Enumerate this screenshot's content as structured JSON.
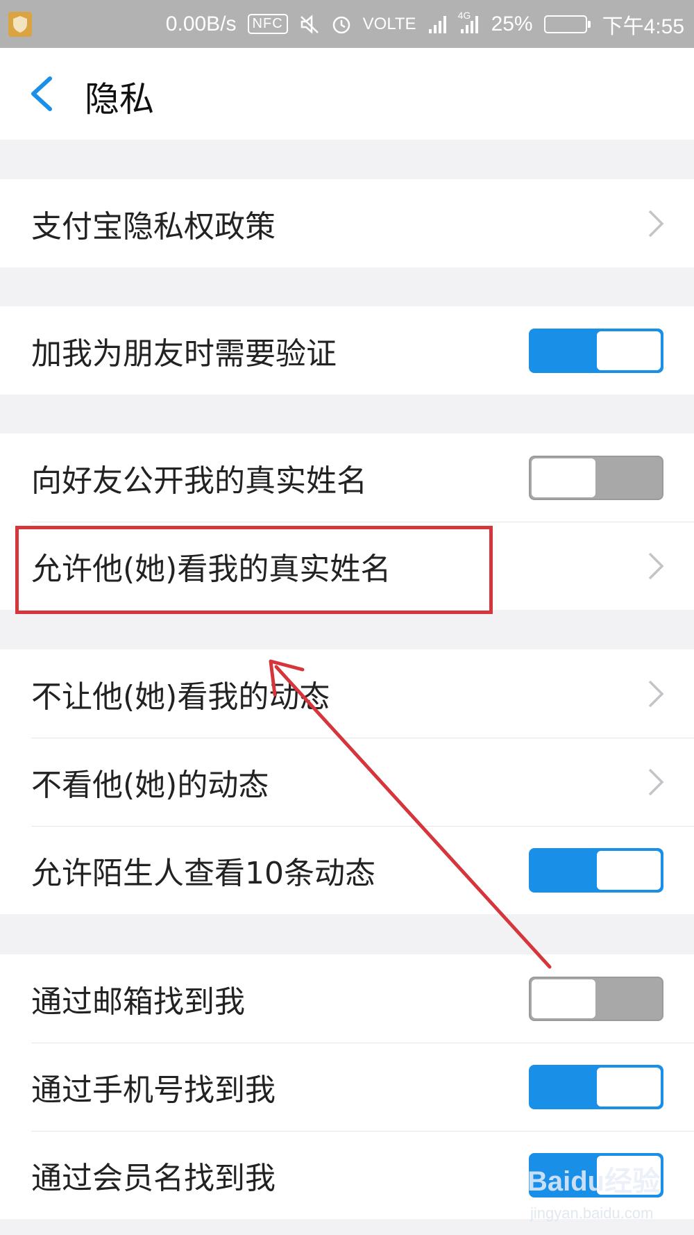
{
  "status_bar": {
    "speed": "0.00B/s",
    "nfc": "NFC",
    "volte": "VOLTE",
    "network": "4G",
    "battery": "25%",
    "battery_level": 0.25,
    "time": "下午4:55",
    "colors": {
      "background": "#b2b2b2",
      "battery_fill": "#5bd04a"
    }
  },
  "header": {
    "title": "隐私",
    "back_icon": "chevron-left-icon",
    "accent_color": "#1a8fe8"
  },
  "sections": [
    {
      "rows": [
        {
          "label": "支付宝隐私权政策",
          "control": "chevron"
        }
      ]
    },
    {
      "rows": [
        {
          "label": "加我为朋友时需要验证",
          "control": "toggle",
          "on": true
        }
      ]
    },
    {
      "rows": [
        {
          "label": "向好友公开我的真实姓名",
          "control": "toggle",
          "on": false
        },
        {
          "label": "允许他(她)看我的真实姓名",
          "control": "chevron",
          "highlighted": true
        }
      ]
    },
    {
      "rows": [
        {
          "label": "不让他(她)看我的动态",
          "control": "chevron"
        },
        {
          "label": "不看他(她)的动态",
          "control": "chevron"
        },
        {
          "label": "允许陌生人查看10条动态",
          "control": "toggle",
          "on": true
        }
      ]
    },
    {
      "rows": [
        {
          "label": "通过邮箱找到我",
          "control": "toggle",
          "on": false
        },
        {
          "label": "通过手机号找到我",
          "control": "toggle",
          "on": true
        },
        {
          "label": "通过会员名找到我",
          "control": "toggle",
          "on": true
        }
      ]
    }
  ],
  "colors": {
    "toggle_on": "#1a8fe8",
    "toggle_off": "#a8a8a8",
    "annotation": "#d6353b"
  },
  "watermark": {
    "brand": "Baidu经验",
    "url": "jingyan.baidu.com"
  }
}
